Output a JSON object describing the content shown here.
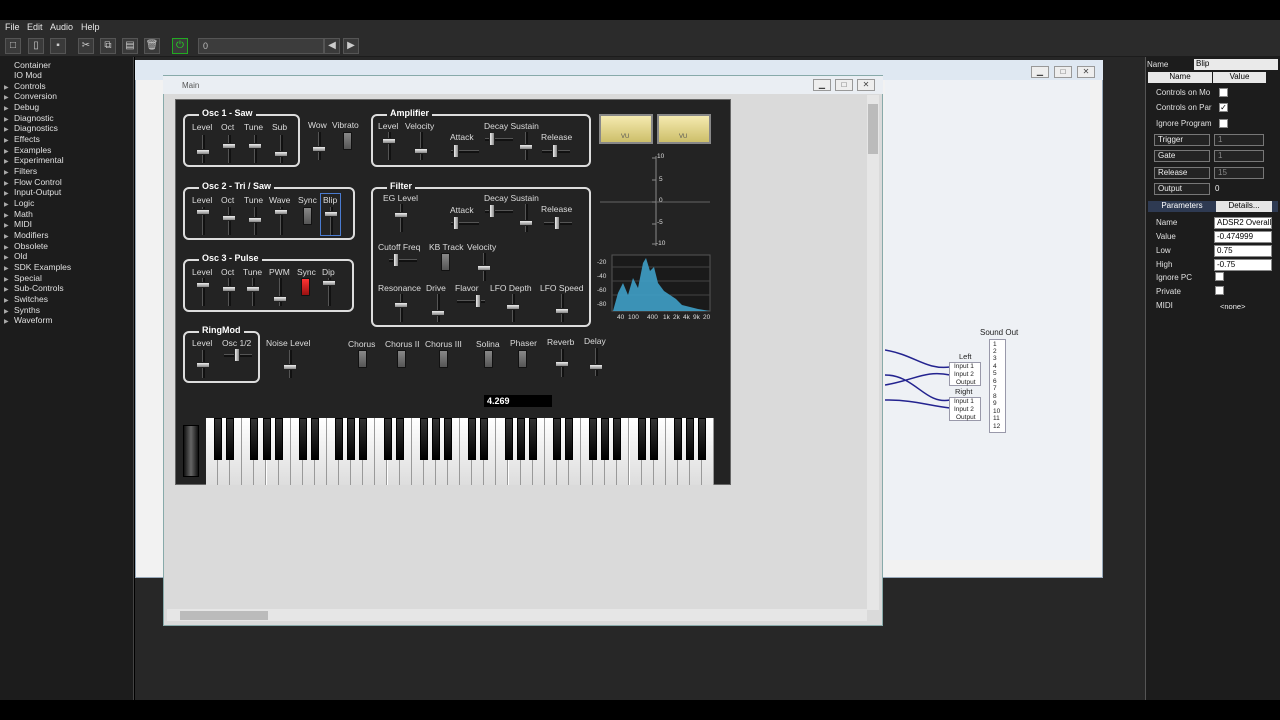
{
  "menu": [
    "File",
    "Edit",
    "Audio",
    "Help"
  ],
  "toolbar": {
    "position_value": "0"
  },
  "tree": [
    "Container",
    "IO Mod",
    "Controls",
    "Conversion",
    "Debug",
    "Diagnostic",
    "Diagnostics",
    "Effects",
    "Examples",
    "Experimental",
    "Filters",
    "Flow Control",
    "Input-Output",
    "Logic",
    "Math",
    "MIDI",
    "Modifiers",
    "Obsolete",
    "Old",
    "SDK Examples",
    "Special",
    "Sub-Controls",
    "Switches",
    "Synths",
    "Waveform"
  ],
  "patch": {
    "sound_out": "Sound Out",
    "left": "Left",
    "right": "Right",
    "input1": "Input 1",
    "input2": "Input 2",
    "output": "Output",
    "channels": [
      "1",
      "2",
      "3",
      "4",
      "5",
      "6",
      "7",
      "8",
      "9",
      "10",
      "11",
      "12"
    ]
  },
  "main": {
    "title": "Main",
    "osc1": {
      "title": "Osc 1 - Saw",
      "labels": [
        "Level",
        "Oct",
        "Tune",
        "Sub"
      ]
    },
    "wow": "Wow",
    "vibrato": "Vibrato",
    "osc2": {
      "title": "Osc 2 - Tri / Saw",
      "labels": [
        "Level",
        "Oct",
        "Tune",
        "Wave",
        "Sync",
        "Blip"
      ]
    },
    "osc3": {
      "title": "Osc 3 - Pulse",
      "labels": [
        "Level",
        "Oct",
        "Tune",
        "PWM",
        "Sync",
        "Dip"
      ]
    },
    "ringmod": {
      "title": "RingMod",
      "labels": [
        "Level",
        "Osc 1/2"
      ]
    },
    "noise_level": "Noise Level",
    "amplifier": {
      "title": "Amplifier",
      "level": "Level",
      "velocity": "Velocity",
      "decay_sustain": "Decay Sustain",
      "attack": "Attack",
      "release": "Release"
    },
    "filter": {
      "title": "Filter",
      "eg_level": "EG Level",
      "decay_sustain": "Decay Sustain",
      "attack": "Attack",
      "release": "Release",
      "cutoff": "Cutoff Freq",
      "kb_track": "KB Track",
      "velocity": "Velocity",
      "resonance": "Resonance",
      "drive": "Drive",
      "flavor": "Flavor",
      "lfo_depth": "LFO Depth",
      "lfo_speed": "LFO Speed"
    },
    "effects": [
      "Chorus",
      "Chorus II",
      "Chorus III",
      "Solina",
      "Phaser",
      "Reverb",
      "Delay"
    ],
    "vu": "VU",
    "scope_ticks": [
      "10",
      "5",
      "0",
      "-5",
      "-10"
    ],
    "spectrum_db": [
      "-20",
      "-40",
      "-60",
      "-80"
    ],
    "spectrum_freq": [
      "40",
      "100",
      "400",
      "1k",
      "2k",
      "4k",
      "9k",
      "20"
    ],
    "readout": "4.269"
  },
  "props": {
    "name_label": "Name",
    "name_value": "Blip",
    "col_name": "Name",
    "col_value": "Value",
    "controls_on_mo": "Controls on Mo",
    "controls_on_par": "Controls on Par",
    "ignore_program": "Ignore Program",
    "trigger": "Trigger",
    "trigger_val": "1",
    "gate": "Gate",
    "gate_val": "1",
    "release": "Release",
    "release_val": "15",
    "output": "Output",
    "output_val": "0",
    "tab_parameters": "Parameters",
    "tab_details": "Details...",
    "p_name": "Name",
    "p_name_val": "ADSR2 Overall L",
    "p_value": "Value",
    "p_value_val": "-0.474999",
    "p_low": "Low",
    "p_low_val": "0.75",
    "p_high": "High",
    "p_high_val": "-0.75",
    "p_ignore_pc": "Ignore PC",
    "p_private": "Private",
    "p_midi": "MIDI",
    "p_midi_val": "<none>"
  }
}
